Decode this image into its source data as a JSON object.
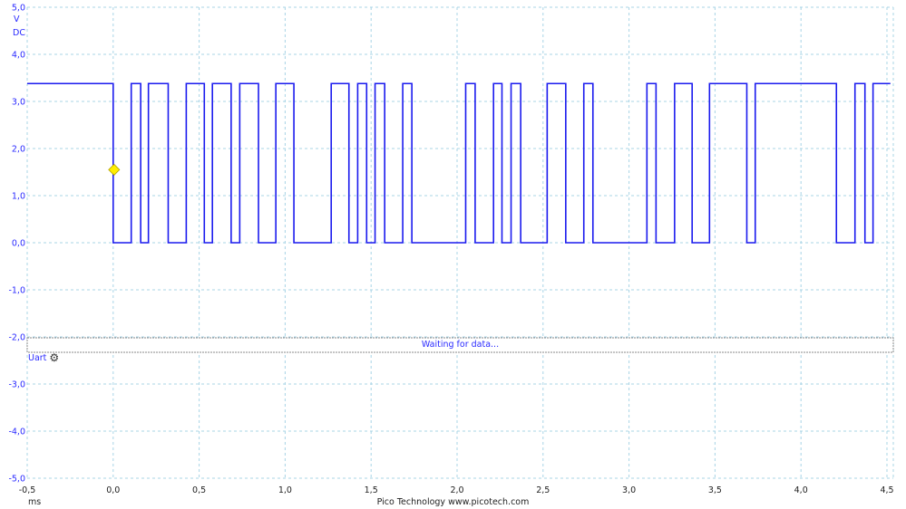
{
  "y_axis": {
    "unit": "V",
    "coupling": "DC",
    "ticks": [
      "5,0",
      "4,0",
      "3,0",
      "2,0",
      "1,0",
      "0,0",
      "-1,0",
      "-2,0",
      "-3,0",
      "-4,0",
      "-5,0"
    ],
    "range": [
      -5,
      5
    ]
  },
  "x_axis": {
    "unit": "ms",
    "ticks": [
      "-0,5",
      "0,0",
      "0,5",
      "1,0",
      "1,5",
      "2,0",
      "2,5",
      "3,0",
      "3,5",
      "4,0",
      "4,5"
    ],
    "range": [
      -0.5,
      4.5
    ]
  },
  "trigger": {
    "time_ms": 0.0,
    "level_v": 1.55,
    "color": "#ffee00"
  },
  "trace": {
    "color": "#1a1aee",
    "high_v": 3.38,
    "low_v": 0.0,
    "start_ms": -0.5,
    "end_ms": 4.52,
    "start_level": "high",
    "edges_ms": [
      0.0,
      0.105,
      0.16,
      0.205,
      0.32,
      0.425,
      0.53,
      0.577,
      0.686,
      0.736,
      0.845,
      0.946,
      1.051,
      1.268,
      1.371,
      1.422,
      1.474,
      1.523,
      1.579,
      1.684,
      1.737,
      2.05,
      2.105,
      2.212,
      2.261,
      2.314,
      2.37,
      2.524,
      2.632,
      2.737,
      2.79,
      3.104,
      3.157,
      3.265,
      3.367,
      3.468,
      3.685,
      3.734,
      4.206,
      4.314,
      4.372,
      4.419
    ]
  },
  "decoder": {
    "name": "Uart",
    "status": "Waiting for data..."
  },
  "footer": {
    "text": "Pico Technology   www.picotech.com"
  }
}
